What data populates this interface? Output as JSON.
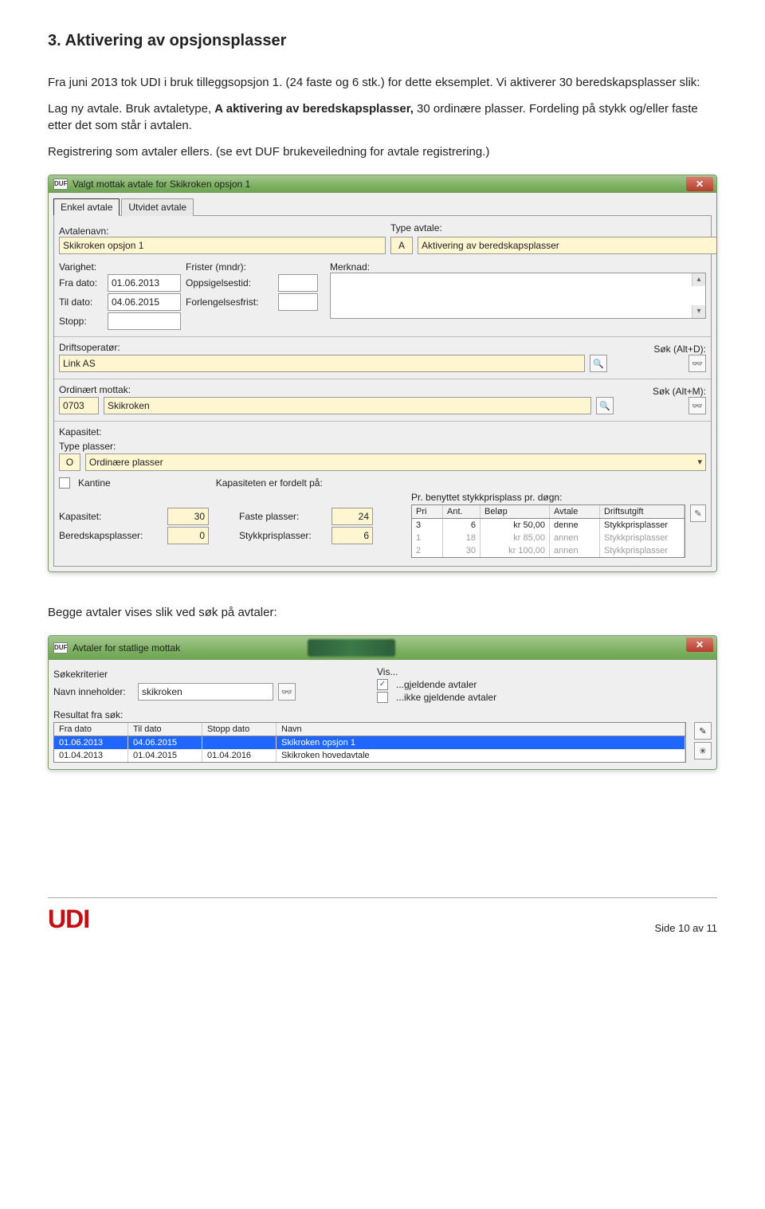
{
  "heading": "3. Aktivering av opsjonsplasser",
  "para1": "Fra juni 2013 tok UDI i bruk tilleggsopsjon 1. (24 faste og 6 stk.) for dette eksemplet. Vi aktiverer 30 beredskapsplasser slik:",
  "para2_plain1": "Lag ny avtale. Bruk avtaletype, ",
  "para2_bold": "A aktivering av beredskapsplasser,",
  "para2_plain2": " 30 ordinære plasser. Fordeling på stykk og/eller faste etter det som står i avtalen.",
  "para3": "Registrering som avtaler ellers. (se evt DUF brukeveiledning for avtale registrering.)",
  "caption2": "Begge avtaler vises slik ved søk på avtaler:",
  "window1": {
    "title_prefix": "DUF",
    "title": "Valgt mottak avtale for Skikroken opsjon 1",
    "tabs": {
      "enkel": "Enkel avtale",
      "utvidet": "Utvidet avtale"
    },
    "labels": {
      "avtalenavn": "Avtalenavn:",
      "type_avtale": "Type avtale:",
      "varighet": "Varighet:",
      "frister": "Frister (mndr):",
      "merknad": "Merknad:",
      "fra_dato": "Fra dato:",
      "til_dato": "Til dato:",
      "stopp": "Stopp:",
      "oppsigelsestid": "Oppsigelsestid:",
      "forlengelsesfrist": "Forlengelsesfrist:",
      "driftsoperator": "Driftsoperatør:",
      "sok_d": "Søk (Alt+D):",
      "ordinart_mottak": "Ordinært mottak:",
      "sok_m": "Søk (Alt+M):",
      "kapasitet_hdr": "Kapasitet:",
      "type_plasser": "Type plasser:",
      "kantine": "Kantine",
      "kap_fordelt": "Kapasiteten er fordelt på:",
      "pr_dogn": "Pr. benyttet stykkprisplass pr. døgn:",
      "kapasitet": "Kapasitet:",
      "beredskapsplasser": "Beredskapsplasser:",
      "faste_plasser": "Faste plasser:",
      "stykkprisplasser": "Stykkprisplasser:"
    },
    "values": {
      "avtalenavn": "Skikroken opsjon 1",
      "type_code": "A",
      "type_text": "Aktivering av beredskapsplasser",
      "fra_dato": "01.06.2013",
      "til_dato": "04.06.2015",
      "driftsoperator": "Link AS",
      "mottak_code": "0703",
      "mottak_name": "Skikroken",
      "type_plasser_code": "O",
      "type_plasser_text": "Ordinære plasser",
      "kapasitet": "30",
      "beredskapsplasser": "0",
      "faste_plasser": "24",
      "stykkprisplasser": "6"
    },
    "price_table": {
      "headers": {
        "pri": "Pri",
        "ant": "Ant.",
        "belop": "Beløp",
        "avtale": "Avtale",
        "drift": "Driftsutgift"
      },
      "rows": [
        {
          "pri": "3",
          "ant": "6",
          "belop": "kr 50,00",
          "avtale": "denne",
          "drift": "Stykkprisplasser"
        },
        {
          "pri": "1",
          "ant": "18",
          "belop": "kr 85,00",
          "avtale": "annen",
          "drift": "Stykkprisplasser"
        },
        {
          "pri": "2",
          "ant": "30",
          "belop": "kr 100,00",
          "avtale": "annen",
          "drift": "Stykkprisplasser"
        }
      ]
    }
  },
  "window2": {
    "title": "Avtaler for statlige mottak",
    "labels": {
      "sokekriterier": "Søkekriterier",
      "vis": "Vis...",
      "navn_inneholder": "Navn inneholder:",
      "gjeldende": "...gjeldende avtaler",
      "ikke_gjeldende": "...ikke gjeldende avtaler",
      "resultat": "Resultat fra søk:"
    },
    "search_value": "skikroken",
    "table": {
      "headers": {
        "fra": "Fra dato",
        "til": "Til dato",
        "stopp": "Stopp dato",
        "navn": "Navn"
      },
      "rows": [
        {
          "fra": "01.06.2013",
          "til": "04.06.2015",
          "stopp": "",
          "navn": "Skikroken opsjon 1",
          "selected": true
        },
        {
          "fra": "01.04.2013",
          "til": "01.04.2015",
          "stopp": "01.04.2016",
          "navn": "Skikroken hovedavtale",
          "selected": false
        }
      ]
    }
  },
  "footer": {
    "logo": "UDI",
    "page": "Side 10 av 11"
  }
}
